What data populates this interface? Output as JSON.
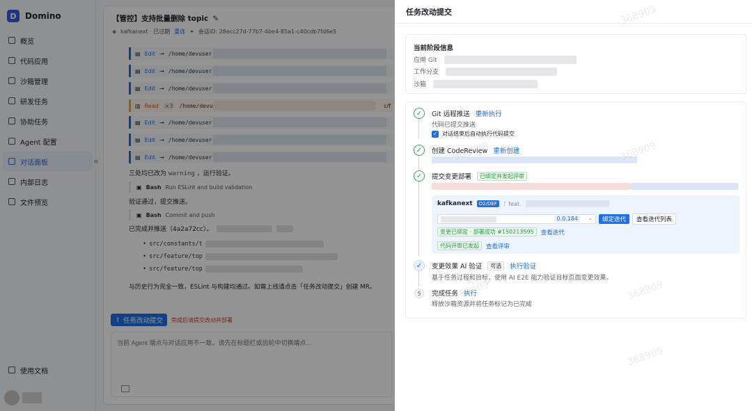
{
  "app": {
    "name": "Domino",
    "logo_letter": "D"
  },
  "sidebar": {
    "items": [
      {
        "label": "概览",
        "active": false
      },
      {
        "label": "代码应用",
        "active": false
      },
      {
        "label": "沙箱管理",
        "active": false
      },
      {
        "label": "研发任务",
        "active": false
      },
      {
        "label": "协助任务",
        "active": false
      },
      {
        "label": "Agent 配置",
        "active": false
      },
      {
        "label": "对话面板",
        "active": true
      },
      {
        "label": "内部日志",
        "active": false
      },
      {
        "label": "文件预览",
        "active": false
      }
    ],
    "bottom_item": "使用文档"
  },
  "chat": {
    "title": "【管控】支持批量删除 topic",
    "sub_name": "kafkanext · 已过期",
    "sub_link": "重连",
    "session_id": "会话ID: 28ecc27d-77b7-4be4-85a1-c40cdb7fd6e5",
    "tools": [
      {
        "kind": "Edit",
        "path": "/home/devuser"
      },
      {
        "kind": "Edit",
        "path": "/home/devuser"
      },
      {
        "kind": "Edit",
        "path": "/home/devuser"
      },
      {
        "kind": "Read",
        "count": "×3",
        "path": "/home/devus",
        "suffix": "c/f"
      },
      {
        "kind": "Edit",
        "path": "/home/devuser"
      },
      {
        "kind": "Edit",
        "path": "/home/devuser"
      },
      {
        "kind": "Edit",
        "path": "/home/devuser"
      }
    ],
    "msg1_prefix": "三处均已改为",
    "msg1_code": "warning",
    "msg1_suffix": "，运行验证。",
    "bash1": {
      "kind": "Bash",
      "desc": "Run ESLint and build validation"
    },
    "msg2": "验证通过，提交推送。",
    "bash2": {
      "kind": "Bash",
      "desc": "Commit and push"
    },
    "msg3": "已完成并推送（4a2a72cc）。",
    "bullets": [
      "src/constants/t",
      "src/feature/top",
      "src/feature/top"
    ],
    "msg4": "与历史行为完全一致，ESLint 与构建均通过。如需上线请点击「任务改动提交」创建 MR。",
    "submit_button": "任务改动提交",
    "submit_warning": "完成后请提交改动并部署",
    "input_placeholder": "当前 Agent 端点与对话应用不一致，请先在标题栏或齿轮中切换端点..."
  },
  "drawer": {
    "title": "任务改动提交",
    "stage": {
      "heading": "当前阶段信息",
      "rows": [
        {
          "label": "应用 Git"
        },
        {
          "label": "工作分支"
        },
        {
          "label": "沙箱"
        }
      ]
    },
    "steps": [
      {
        "title": "Git 远程推送",
        "action": "重新执行",
        "desc": "代码已提交推送",
        "checkbox": "对话结束后自动执行代码提交"
      },
      {
        "title": "创建 CodeReview",
        "action": "重新创建"
      },
      {
        "title": "提交变更部署",
        "tag": "已绑定并发起评审"
      },
      {
        "title": "变更效果 AI 验证",
        "tag": "可选",
        "action": "执行验证",
        "desc": "基于任务过程和目标，使用 AI E2E 能力验证目标页面变更效果。"
      },
      {
        "number": "5",
        "title": "完成任务",
        "action": "执行",
        "desc": "释放沙箱资源并将任务标记为已完成"
      }
    ],
    "deploy": {
      "app": "kafkanext",
      "env": "O2/DEF",
      "branch": "feat.",
      "version": "0.0.184",
      "bind_button": "绑定迭代",
      "list_button": "查看迭代列表",
      "status_tag": "变更已绑定 · 部署成功 #150213595",
      "status_link": "查看迭代",
      "review_tag": "代码评审已发起",
      "review_link": "查看评审"
    }
  },
  "watermark": "368909"
}
